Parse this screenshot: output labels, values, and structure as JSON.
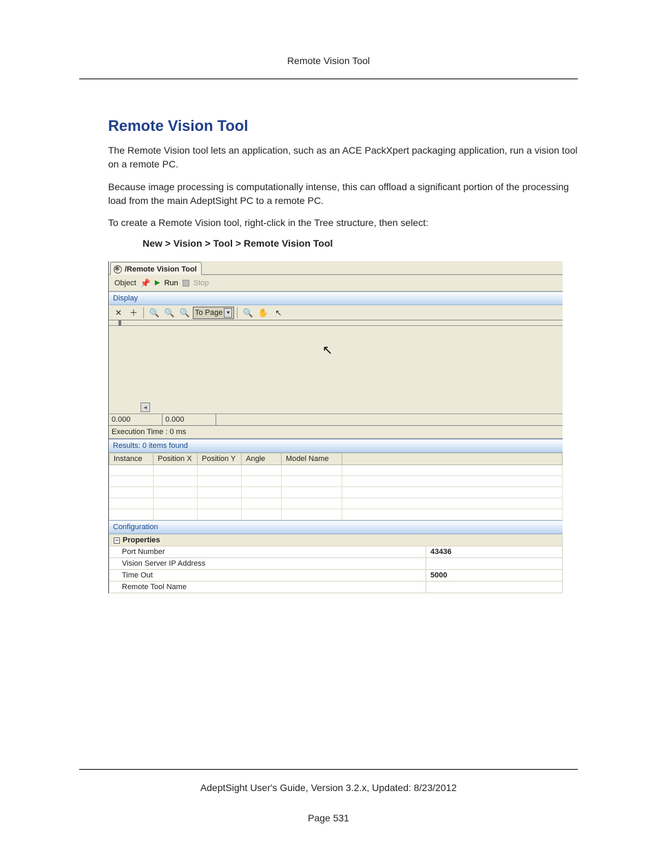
{
  "header": {
    "title": "Remote Vision Tool"
  },
  "section": {
    "heading": "Remote Vision Tool",
    "p1": "The Remote Vision tool lets an application, such as an ACE PackXpert packaging application, run a vision tool on a remote PC.",
    "p2": "Because image processing is computationally intense, this can offload a significant portion of the processing load from the main AdeptSight PC to a remote PC.",
    "p3": "To create a Remote Vision tool, right-click in the Tree structure, then select:",
    "nav_path": "New > Vision > Tool > Remote Vision Tool"
  },
  "app": {
    "tab_label": "/Remote Vision Tool",
    "toolbar1": {
      "object": "Object",
      "run": "Run",
      "stop": "Stop"
    },
    "display_header": "Display",
    "toolbar2": {
      "to_page": "To Page"
    },
    "coords": {
      "x": "0.000",
      "y": "0.000"
    },
    "exec_time": "Execution Time : 0 ms",
    "results_header": "Results: 0 items found",
    "columns": {
      "instance": "Instance",
      "posx": "Position X",
      "posy": "Position Y",
      "angle": "Angle",
      "model": "Model Name"
    },
    "config_header": "Configuration",
    "properties": {
      "group": "Properties",
      "port_label": "Port Number",
      "port_value": "43436",
      "ip_label": "Vision Server IP Address",
      "ip_value": "",
      "timeout_label": "Time Out",
      "timeout_value": "5000",
      "remote_label": "Remote Tool Name",
      "remote_value": ""
    }
  },
  "footer": {
    "guide": "AdeptSight User's Guide,  Version 3.2.x, Updated: 8/23/2012",
    "page": "Page 531"
  }
}
